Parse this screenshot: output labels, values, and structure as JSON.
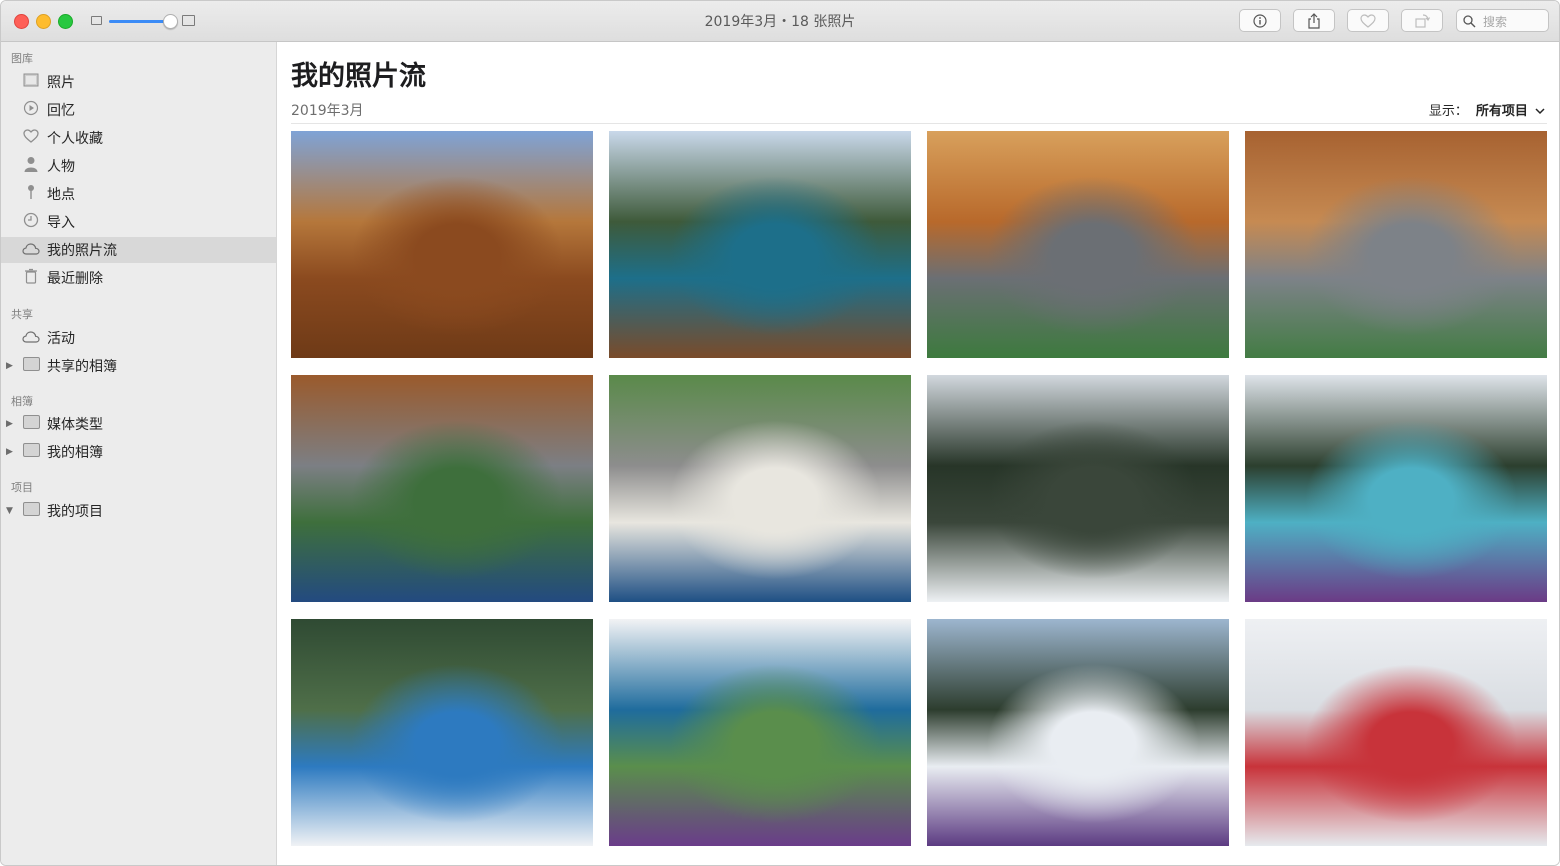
{
  "window": {
    "title": "2019年3月・18 张照片"
  },
  "toolbar": {
    "info_icon": "info-icon",
    "share_icon": "share-icon",
    "favorite_icon": "heart-icon",
    "rotate_icon": "rotate-icon",
    "search_placeholder": "搜索",
    "zoom_level": 0.9
  },
  "sidebar": {
    "sections": [
      {
        "title": "图库",
        "items": [
          {
            "label": "照片",
            "icon": "photos-icon"
          },
          {
            "label": "回忆",
            "icon": "memories-icon"
          },
          {
            "label": "个人收藏",
            "icon": "heart-icon"
          },
          {
            "label": "人物",
            "icon": "person-icon"
          },
          {
            "label": "地点",
            "icon": "pin-icon"
          },
          {
            "label": "导入",
            "icon": "clock-icon"
          },
          {
            "label": "我的照片流",
            "icon": "cloud-icon",
            "selected": true
          },
          {
            "label": "最近删除",
            "icon": "trash-icon"
          }
        ]
      },
      {
        "title": "共享",
        "items": [
          {
            "label": "活动",
            "icon": "cloud-icon"
          },
          {
            "label": "共享的相簿",
            "icon": "folder-icon"
          }
        ]
      },
      {
        "title": "相簿",
        "items": [
          {
            "label": "媒体类型",
            "icon": "folder-icon"
          },
          {
            "label": "我的相簿",
            "icon": "folder-icon"
          }
        ]
      },
      {
        "title": "项目",
        "items": [
          {
            "label": "我的项目",
            "icon": "folder-icon"
          }
        ]
      }
    ]
  },
  "main": {
    "title": "我的照片流",
    "date": "2019年3月",
    "show_label": "显示：",
    "show_value": "所有项目",
    "photos": [
      {
        "scene": "kids-on-cabin-deck",
        "sky": "#7fa3d6",
        "top": "#b5773b",
        "mid": "#8b4a1f",
        "bottom": "#6e3a17"
      },
      {
        "scene": "girl-drinking-forest",
        "sky": "#c9d8ea",
        "top": "#3e5a3a",
        "mid": "#1d6f8a",
        "bottom": "#7a4b2a"
      },
      {
        "scene": "boy-drinking-closeup",
        "sky": "#d8a05c",
        "top": "#b8692b",
        "mid": "#6b6f74",
        "bottom": "#3d7a3e"
      },
      {
        "scene": "boy-smiling-jacket",
        "sky": "#a76231",
        "top": "#c68a52",
        "mid": "#7d8288",
        "bottom": "#437c44"
      },
      {
        "scene": "boy-with-marshmallow-mug",
        "sky": "#9a5a2c",
        "top": "#7c7f84",
        "mid": "#3e6f3c",
        "bottom": "#234a80"
      },
      {
        "scene": "marshmallow-mug-overhead",
        "sky": "#5a8a4a",
        "top": "#8d8d8d",
        "mid": "#e8e6df",
        "bottom": "#1e4f84"
      },
      {
        "scene": "snowshoe-forest",
        "sky": "#d2d8de",
        "top": "#273528",
        "mid": "#3a463a",
        "bottom": "#eef1f4"
      },
      {
        "scene": "girl-colorful-beanie",
        "sky": "#dfe4ea",
        "top": "#2c3f2e",
        "mid": "#4eb0c4",
        "bottom": "#6b3b86"
      },
      {
        "scene": "family-in-snow",
        "sky": "#2f4a33",
        "top": "#4f6f49",
        "mid": "#2d7ac0",
        "bottom": "#f0f2f5"
      },
      {
        "scene": "family-lying-in-snow",
        "sky": "#f2f3f5",
        "top": "#1f6c9d",
        "mid": "#5a8e4c",
        "bottom": "#6a3c8a"
      },
      {
        "scene": "snowshoe-meadow",
        "sky": "#9db6cf",
        "top": "#2d3d2e",
        "mid": "#e9edf2",
        "bottom": "#5c3b82"
      },
      {
        "scene": "kids-in-deep-snow",
        "sky": "#eef0f3",
        "top": "#d9dde2",
        "mid": "#c8333a",
        "bottom": "#e6eaee"
      }
    ]
  }
}
